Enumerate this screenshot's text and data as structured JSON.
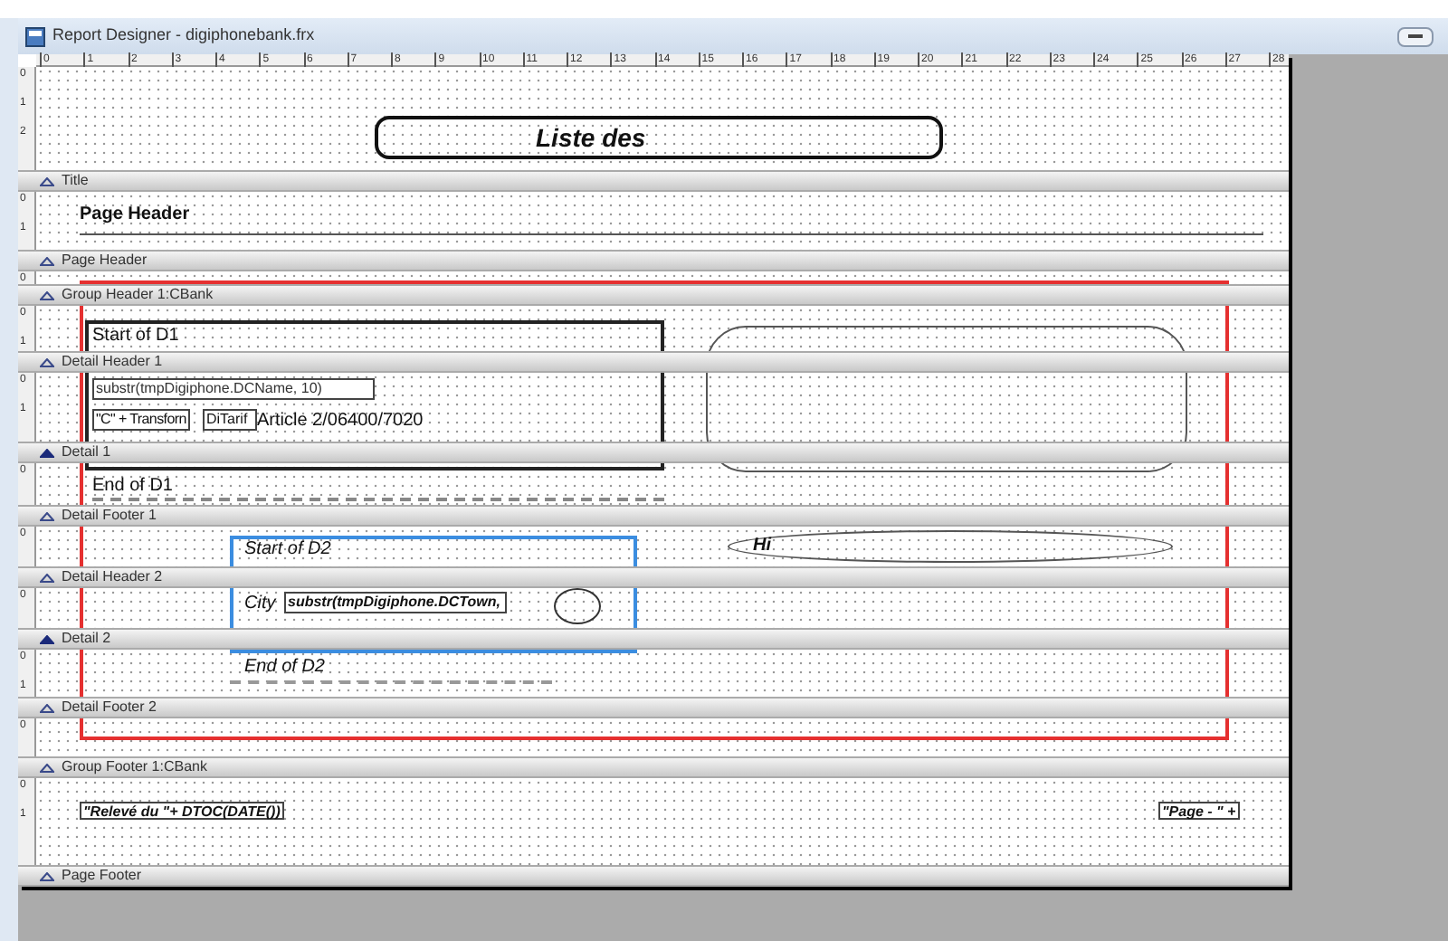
{
  "window": {
    "title": "Report Designer - digiphonebank.frx"
  },
  "ruler": {
    "marks": [
      "0",
      "1",
      "2",
      "3",
      "4",
      "5",
      "6",
      "7",
      "8",
      "9",
      "10",
      "11",
      "12",
      "13",
      "14",
      "15",
      "16",
      "17",
      "18",
      "19",
      "20",
      "21",
      "22",
      "23",
      "24",
      "25",
      "26",
      "27",
      "28"
    ]
  },
  "bands": [
    {
      "label": "Title",
      "kind": "section",
      "ruler": [
        "0",
        "1",
        "2"
      ]
    },
    {
      "label": "Page Header",
      "kind": "section",
      "ruler": [
        "0",
        "1"
      ]
    },
    {
      "label": "Group Header 1:CBank",
      "kind": "section",
      "ruler": [
        "0"
      ]
    },
    {
      "label": "Detail Header 1",
      "kind": "section",
      "ruler": [
        "0",
        "1"
      ]
    },
    {
      "label": "Detail 1",
      "kind": "detail",
      "ruler": [
        "0",
        "1"
      ]
    },
    {
      "label": "Detail Footer 1",
      "kind": "section",
      "ruler": [
        "0"
      ]
    },
    {
      "label": "Detail Header 2",
      "kind": "section",
      "ruler": [
        "0"
      ]
    },
    {
      "label": "Detail 2",
      "kind": "detail",
      "ruler": [
        "0"
      ]
    },
    {
      "label": "Detail Footer 2",
      "kind": "section",
      "ruler": [
        "0",
        "1"
      ]
    },
    {
      "label": "Group Footer 1:CBank",
      "kind": "section",
      "ruler": [
        "0"
      ]
    },
    {
      "label": "Page Footer",
      "kind": "section",
      "ruler": [
        "0",
        "1"
      ]
    }
  ],
  "objects": [
    {
      "kind": "box",
      "text": "Liste des"
    },
    {
      "kind": "label",
      "text": "Page Header"
    },
    {
      "kind": "label",
      "text": "Start of D1"
    },
    {
      "kind": "field",
      "text": "substr(tmpDigiphone.DCName, 10)"
    },
    {
      "kind": "field",
      "text": "\"C\" + Transforn"
    },
    {
      "kind": "field",
      "text": "DiTarif"
    },
    {
      "kind": "label",
      "text": "Article 2/06400/7020"
    },
    {
      "kind": "label",
      "text": "End of D1"
    },
    {
      "kind": "label",
      "text": "Start of D2"
    },
    {
      "kind": "oval",
      "text": "Hi"
    },
    {
      "kind": "label",
      "text": "City"
    },
    {
      "kind": "field",
      "text": "substr(tmpDigiphone.DCTown,"
    },
    {
      "kind": "label",
      "text": "End of D2"
    },
    {
      "kind": "field",
      "text": "\"Relevé du \"+ DTOC(DATE())"
    },
    {
      "kind": "field",
      "text": "\"Page - \" +"
    }
  ]
}
